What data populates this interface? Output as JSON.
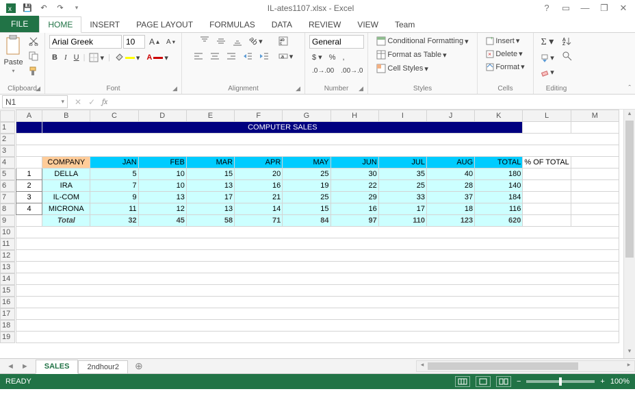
{
  "app": {
    "title": "IL-ates1107.xlsx - Excel"
  },
  "qat": {
    "save": "💾",
    "undo": "↶",
    "redo": "↷"
  },
  "winbtns": {
    "help": "?",
    "ropts": "▭",
    "min": "—",
    "restore": "❐",
    "close": "✕"
  },
  "tabs": {
    "file": "FILE",
    "home": "HOME",
    "insert": "INSERT",
    "pagelayout": "PAGE LAYOUT",
    "formulas": "FORMULAS",
    "data": "DATA",
    "review": "REVIEW",
    "view": "VIEW",
    "team": "Team"
  },
  "ribbon": {
    "clipboard": {
      "label": "Clipboard",
      "paste": "Paste"
    },
    "font": {
      "label": "Font",
      "name": "Arial Greek",
      "size": "10",
      "bold": "B",
      "italic": "I",
      "underline": "U"
    },
    "alignment": {
      "label": "Alignment",
      "wrap": "Wrap Text",
      "merge": "Merge & Center"
    },
    "number": {
      "label": "Number",
      "format": "General"
    },
    "styles": {
      "label": "Styles",
      "cond": "Conditional Formatting",
      "table": "Format as Table",
      "cell": "Cell Styles"
    },
    "cells": {
      "label": "Cells",
      "insert": "Insert",
      "delete": "Delete",
      "format": "Format"
    },
    "editing": {
      "label": "Editing"
    }
  },
  "namebox": "N1",
  "columns": [
    "A",
    "B",
    "C",
    "D",
    "E",
    "F",
    "G",
    "H",
    "I",
    "J",
    "K",
    "L",
    "M"
  ],
  "banner": "COMPUTER SALES",
  "headers": {
    "company": "COMPANY",
    "jan": "JAN",
    "feb": "FEB",
    "mar": "MAR",
    "apr": "APR",
    "may": "MAY",
    "jun": "JUN",
    "jul": "JUL",
    "aug": "AUG",
    "total": "TOTAL",
    "pct": "% OF TOTAL"
  },
  "rows": [
    {
      "idx": "1",
      "company": "DELLA",
      "m": [
        "5",
        "10",
        "15",
        "20",
        "25",
        "30",
        "35",
        "40"
      ],
      "total": "180"
    },
    {
      "idx": "2",
      "company": "IRA",
      "m": [
        "7",
        "10",
        "13",
        "16",
        "19",
        "22",
        "25",
        "28"
      ],
      "total": "140"
    },
    {
      "idx": "3",
      "company": "IL-COM",
      "m": [
        "9",
        "13",
        "17",
        "21",
        "25",
        "29",
        "33",
        "37"
      ],
      "total": "184"
    },
    {
      "idx": "4",
      "company": "MICRONA",
      "m": [
        "11",
        "12",
        "13",
        "14",
        "15",
        "16",
        "17",
        "18"
      ],
      "total": "116"
    }
  ],
  "totalrow": {
    "company": "Total",
    "m": [
      "32",
      "45",
      "58",
      "71",
      "84",
      "97",
      "110",
      "123"
    ],
    "total": "620"
  },
  "sheets": {
    "s1": "SALES",
    "s2": "2ndhour2"
  },
  "status": {
    "ready": "READY",
    "zoom": "100%"
  }
}
